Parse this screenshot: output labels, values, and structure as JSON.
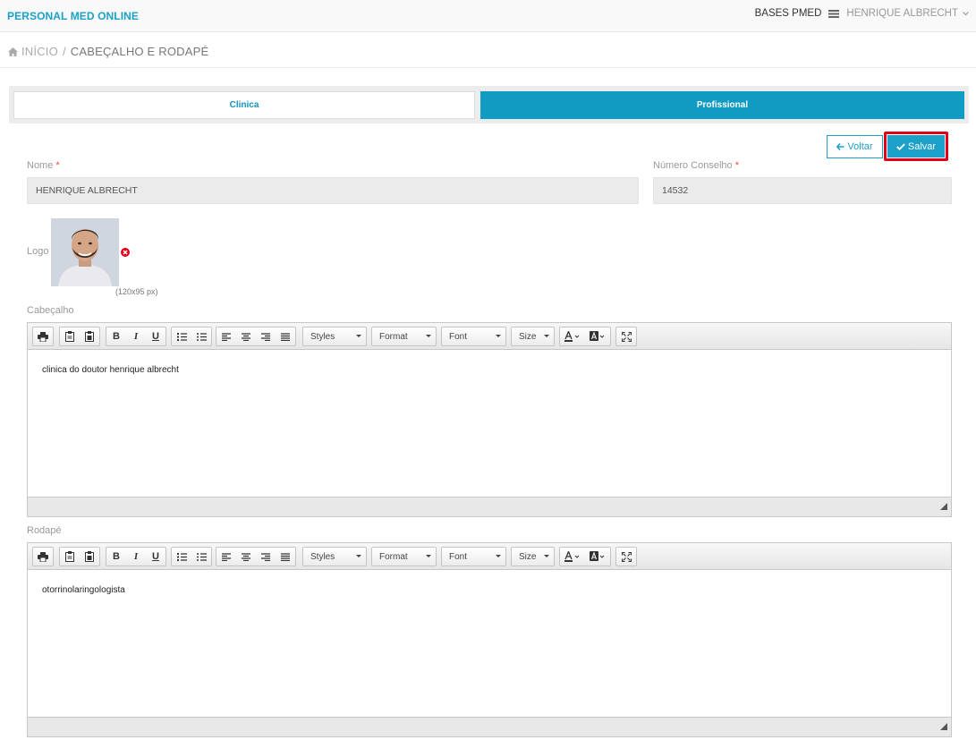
{
  "topbar": {
    "brand": "PERSONAL MED ONLINE",
    "bases_label": "BASES PMED",
    "user_name": "HENRIQUE ALBRECHT"
  },
  "breadcrumb": {
    "home": "INÍCIO",
    "separator": "/",
    "current": "CABEÇALHO E RODAPÉ"
  },
  "tabs": [
    {
      "label": "Clinica",
      "active": false
    },
    {
      "label": "Profissional",
      "active": true
    }
  ],
  "actions": {
    "back_label": "Voltar",
    "save_label": "Salvar"
  },
  "form": {
    "nome_label": "Nome",
    "nome_value": "HENRIQUE ALBRECHT",
    "conselho_label": "Número Conselho",
    "conselho_value": "14532",
    "required_mark": "*",
    "logo_label": "Logo",
    "logo_dimensions": "(120x95 px)",
    "header_label": "Cabeçalho",
    "footer_label": "Rodapé"
  },
  "editor_toolbar": {
    "styles": "Styles",
    "format": "Format",
    "font": "Font",
    "size": "Size",
    "bold": "B",
    "italic": "I",
    "underline": "U"
  },
  "editors": {
    "header_content": "clinica do doutor henrique albrecht",
    "footer_content": "otorrinolaringologista"
  },
  "colors": {
    "accent": "#1ba0c8",
    "tab_active": "#0f9bc2",
    "highlight_outline": "#e3001b",
    "required": "#e84c3d"
  },
  "icons": [
    "home-icon",
    "database-icon",
    "chevron-down-icon",
    "arrow-left-icon",
    "check-icon",
    "remove-icon",
    "print-icon",
    "paste-icon",
    "paste-text-icon",
    "numbered-list-icon",
    "bulleted-list-icon",
    "align-left-icon",
    "align-center-icon",
    "align-right-icon",
    "align-justify-icon",
    "text-color-icon",
    "background-color-icon",
    "maximize-icon",
    "resize-handle-icon"
  ]
}
